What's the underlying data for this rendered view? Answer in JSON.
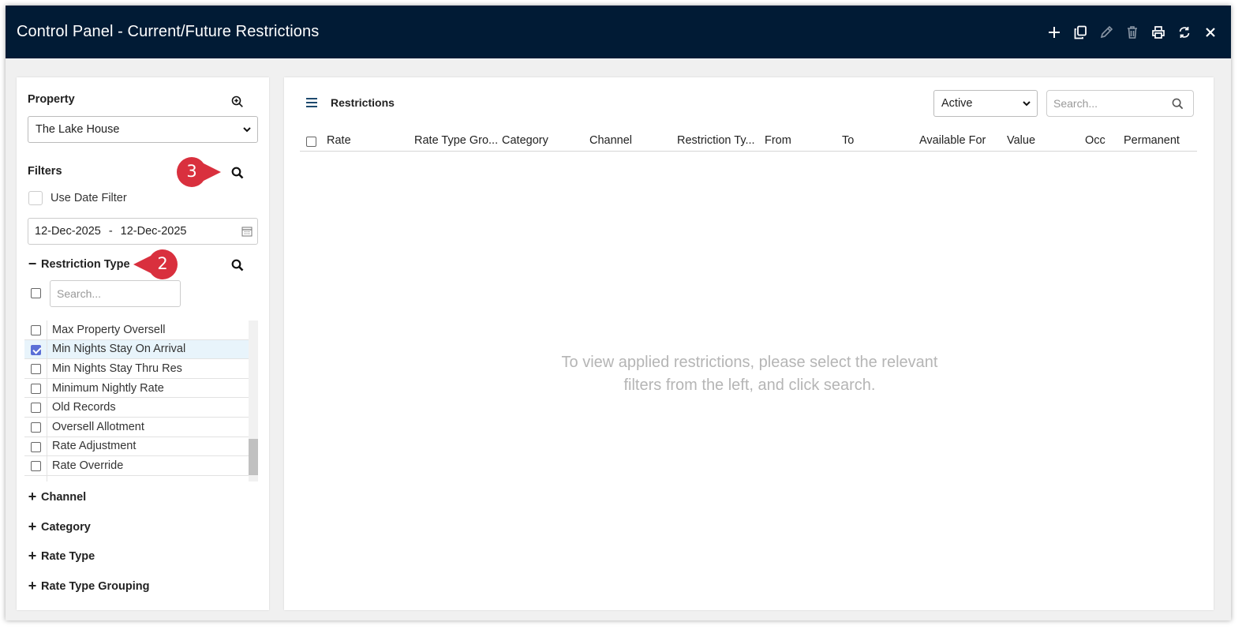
{
  "window": {
    "title": "Control Panel - Current/Future Restrictions",
    "toolbar": [
      "plus-icon",
      "copy-icon",
      "pencil-icon",
      "trash-icon",
      "printer-icon",
      "refresh-icon",
      "close-icon"
    ]
  },
  "left_panel": {
    "property_label": "Property",
    "property_value": "The Lake House",
    "filters_label": "Filters",
    "use_date_filter_label": "Use Date Filter",
    "use_date_filter_checked": false,
    "date_from": "12-Dec-2025",
    "date_separator": "-",
    "date_to": "12-Dec-2025",
    "restriction_type": {
      "label": "Restriction Type",
      "search_placeholder": "Search...",
      "items": [
        {
          "label": "Max Property Oversell",
          "checked": false
        },
        {
          "label": "Min Nights Stay On Arrival",
          "checked": true
        },
        {
          "label": "Min Nights Stay Thru Res",
          "checked": false
        },
        {
          "label": "Minimum Nightly Rate",
          "checked": false
        },
        {
          "label": "Old Records",
          "checked": false
        },
        {
          "label": "Oversell Allotment",
          "checked": false
        },
        {
          "label": "Rate Adjustment",
          "checked": false
        },
        {
          "label": "Rate Override",
          "checked": false
        }
      ]
    },
    "groups": [
      "Channel",
      "Category",
      "Rate Type",
      "Rate Type Grouping"
    ]
  },
  "right_panel": {
    "title": "Restrictions",
    "status_select": "Active",
    "search_placeholder": "Search...",
    "columns": [
      "Rate",
      "Rate Type Gro...",
      "Category",
      "Channel",
      "Restriction Ty...",
      "From",
      "To",
      "Available For",
      "Value",
      "Occ",
      "Permanent"
    ],
    "empty_line1": "To view applied restrictions, please select the relevant",
    "empty_line2": "filters from the left, and click search."
  },
  "callouts": {
    "two": "2",
    "three": "3"
  },
  "colors": {
    "titlebar": "#011b35",
    "callout": "#d9303e",
    "checked": "#5b6fd6"
  }
}
